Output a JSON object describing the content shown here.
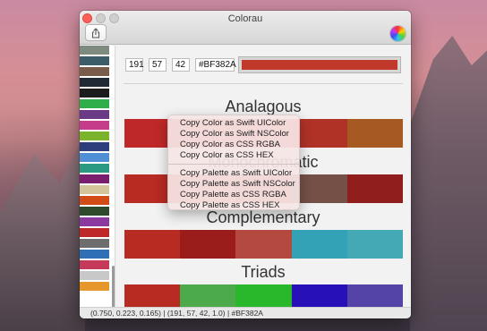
{
  "window": {
    "title": "Colorau"
  },
  "toolbar": {
    "share_icon": "share-icon",
    "color_wheel_icon": "color-wheel-icon"
  },
  "swatches": [
    "#7e8c7f",
    "#3b5d6a",
    "#7a5c4a",
    "#1f2a36",
    "#1c1c1c",
    "#2fae4a",
    "#6b3a86",
    "#c43c8a",
    "#7bb32c",
    "#2c3f7c",
    "#4f8fd6",
    "#2a9a82",
    "#7a1e6e",
    "#d5c59a",
    "#d24a16",
    "#2e4a2a",
    "#8c3aa0",
    "#bf2828",
    "#6e6e6e",
    "#2f6fb6",
    "#c43a58",
    "#c8c8c8",
    "#e6962a"
  ],
  "selected_color": {
    "r": "191",
    "g": "57",
    "b": "42",
    "hex": "#BF382A",
    "swatch": "#BF382A"
  },
  "sections": {
    "analagous": {
      "title": "Analagous",
      "colors": [
        "#bf2828",
        "#bf382a",
        "#bf382a",
        "#b03227",
        "#a65a22"
      ]
    },
    "monochromatic": {
      "title": "Monochromatic",
      "colors": [
        "#b82b23",
        "#c94a37",
        "#a33228",
        "#745047",
        "#8f1e1c"
      ]
    },
    "complementary": {
      "title": "Complementary",
      "colors": [
        "#b82b23",
        "#9a1d1b",
        "#b3493f",
        "#33a2b7",
        "#44a8b5"
      ]
    },
    "triads": {
      "title": "Triads",
      "colors": [
        "#b82b23",
        "#4daa4a",
        "#29b82c",
        "#2810b8",
        "#5544a8"
      ]
    }
  },
  "context_menu": {
    "items": [
      "Copy Color as Swift UIColor",
      "Copy Color as Swift NSColor",
      "Copy Color as CSS RGBA",
      "Copy Color as CSS HEX",
      "Copy Palette as Swift UIColor",
      "Copy Palette as Swift NSColor",
      "Copy Palette as CSS RGBA",
      "Copy Palette as CSS HEX"
    ]
  },
  "status_bar": {
    "text": "(0.750, 0.223, 0.165) | (191, 57, 42, 1.0) | #BF382A"
  }
}
